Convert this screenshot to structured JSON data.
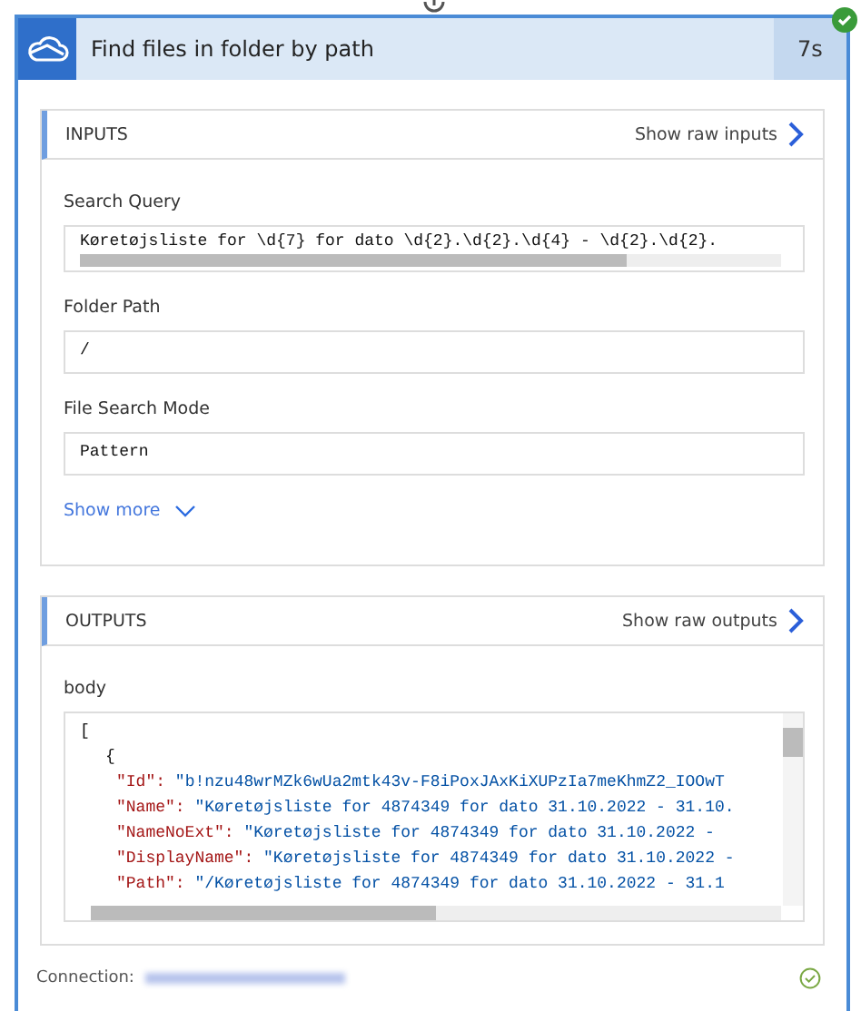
{
  "action": {
    "title": "Find files in folder by path",
    "duration": "7s",
    "succeeded": true
  },
  "inputs": {
    "heading": "INPUTS",
    "raw_link": "Show raw inputs",
    "fields": [
      {
        "label": "Search Query",
        "value": "Køretøjsliste for \\d{7} for dato \\d{2}.\\d{2}.\\d{4} - \\d{2}.\\d{2}.",
        "scrollable": true
      },
      {
        "label": "Folder Path",
        "value": "/",
        "scrollable": false
      },
      {
        "label": "File Search Mode",
        "value": "Pattern",
        "scrollable": false
      }
    ],
    "show_more": "Show more"
  },
  "outputs": {
    "heading": "OUTPUTS",
    "raw_link": "Show raw outputs",
    "body_label": "body",
    "lines": [
      {
        "kind": "punct",
        "text": "["
      },
      {
        "kind": "punct",
        "text": "{"
      },
      {
        "kind": "pair",
        "key": "\"Id\":",
        "value": "\"b!nzu48wrMZk6wUa2mtk43v-F8iPoxJAxKiXUPzIa7meKhmZ2_IOOwT"
      },
      {
        "kind": "pair",
        "key": "\"Name\":",
        "value": "\"Køretøjsliste for 4874349 for dato 31.10.2022 - 31.10."
      },
      {
        "kind": "pair",
        "key": "\"NameNoExt\":",
        "value": "\"Køretøjsliste for 4874349 for dato 31.10.2022 -"
      },
      {
        "kind": "pair",
        "key": "\"DisplayName\":",
        "value": "\"Køretøjsliste for 4874349 for dato 31.10.2022 -"
      },
      {
        "kind": "pair",
        "key": "\"Path\":",
        "value": "\"/Køretøjsliste for 4874349 for dato 31.10.2022 - 31.1"
      }
    ]
  },
  "connection": {
    "label": "Connection:",
    "ok": true
  }
}
